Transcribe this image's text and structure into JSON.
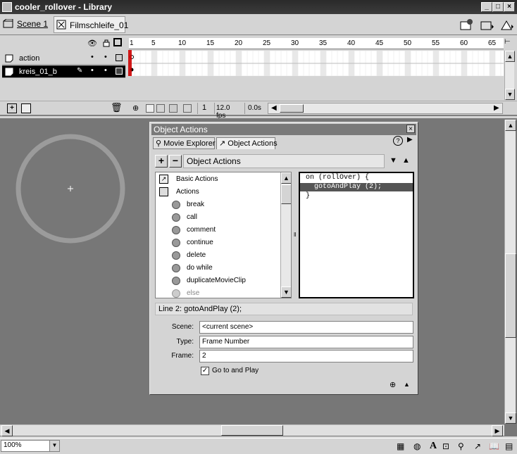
{
  "window": {
    "title": "cooler_rollover - Library",
    "buttons": [
      "_",
      "□",
      "×"
    ]
  },
  "scenebar": {
    "scene_label": "Scene 1",
    "symbol_label": "Filmschleife_01"
  },
  "timeline": {
    "header_icons": [
      "eye-icon",
      "lock-icon",
      "outline-icon"
    ],
    "layers": [
      {
        "name": "action",
        "selected": false
      },
      {
        "name": "kreis_01_b",
        "selected": true
      }
    ],
    "ruler_numbers": [
      "1",
      "5",
      "10",
      "15",
      "20",
      "25",
      "30",
      "35",
      "40",
      "45",
      "50",
      "55",
      "60",
      "65"
    ],
    "footer": {
      "current_frame": "1",
      "frame_rate": "12.0 fps",
      "elapsed_time": "0.0s"
    }
  },
  "panel": {
    "title": "Object Actions",
    "close": "×",
    "tabs": [
      "Movie Explorer",
      "Object Actions"
    ],
    "toolbar_title": "Object Actions",
    "add_label": "+",
    "remove_label": "−",
    "toolbox": {
      "categories": [
        "Basic Actions",
        "Actions"
      ],
      "items": [
        "break",
        "call",
        "comment",
        "continue",
        "delete",
        "do while",
        "duplicateMovieClip",
        "else"
      ]
    },
    "script": {
      "lines": [
        "on (rollOver) {",
        "  gotoAndPlay (2);",
        "}"
      ],
      "selected_line": 1
    },
    "status_line": "Line 2: gotoAndPlay (2);",
    "params": {
      "scene_label": "Scene:",
      "scene_value": "<current scene>",
      "type_label": "Type:",
      "type_value": "Frame Number",
      "frame_label": "Frame:",
      "frame_value": "2",
      "goto_play_label": "Go to and Play",
      "goto_play_checked": true
    }
  },
  "statusbar": {
    "zoom": "100%"
  }
}
